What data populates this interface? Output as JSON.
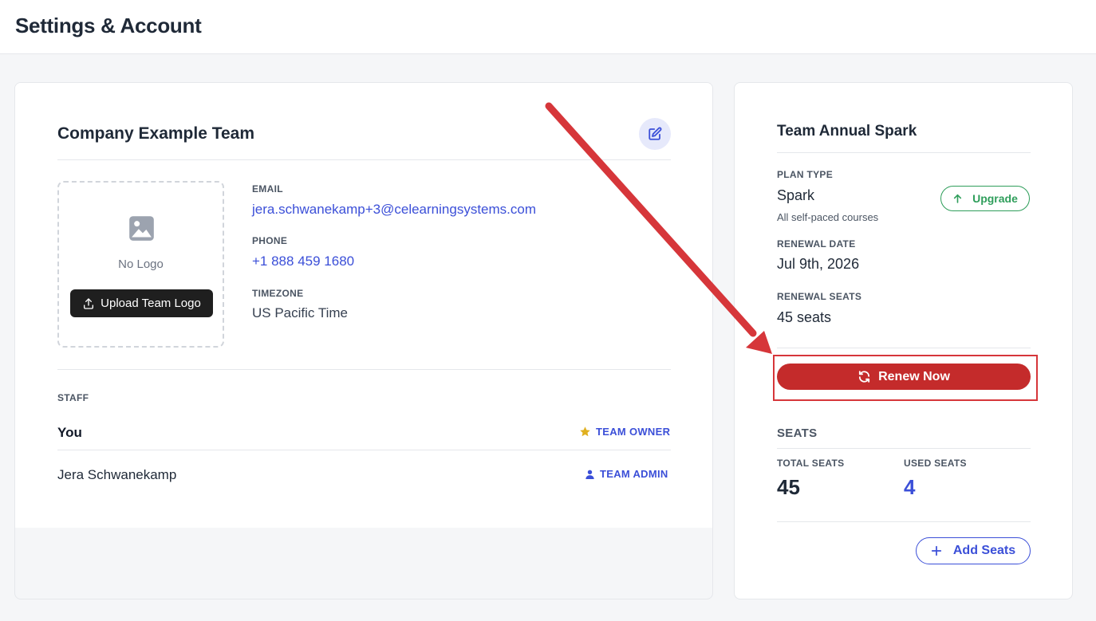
{
  "header": {
    "title": "Settings & Account"
  },
  "team": {
    "name": "Company Example Team",
    "logo": {
      "empty_text": "No Logo",
      "upload_label": "Upload Team Logo"
    },
    "fields": {
      "email_label": "EMAIL",
      "email": "jera.schwanekamp+3@celearningsystems.com",
      "phone_label": "PHONE",
      "phone": "+1 888 459 1680",
      "timezone_label": "TIMEZONE",
      "timezone": "US Pacific Time"
    },
    "staff": {
      "label": "STAFF",
      "members": [
        {
          "name": "You",
          "role": "TEAM OWNER",
          "role_icon": "star-icon"
        },
        {
          "name": "Jera Schwanekamp",
          "role": "TEAM ADMIN",
          "role_icon": "user-icon"
        }
      ]
    }
  },
  "plan": {
    "title": "Team Annual Spark",
    "plan_type_label": "PLAN TYPE",
    "plan_type": "Spark",
    "plan_type_sub": "All self-paced courses",
    "upgrade_label": "Upgrade",
    "renewal_date_label": "RENEWAL DATE",
    "renewal_date": "Jul 9th, 2026",
    "renewal_seats_label": "RENEWAL SEATS",
    "renewal_seats": "45 seats",
    "renew_label": "Renew Now"
  },
  "seats": {
    "heading": "SEATS",
    "total_label": "TOTAL SEATS",
    "total": "45",
    "used_label": "USED SEATS",
    "used": "4",
    "add_label": "Add Seats"
  },
  "colors": {
    "accent": "#3b4fd8",
    "renew": "#c42b2b",
    "upgrade": "#2f9e5b",
    "owner_star": "#e0b020",
    "annotation": "#d6363a"
  }
}
